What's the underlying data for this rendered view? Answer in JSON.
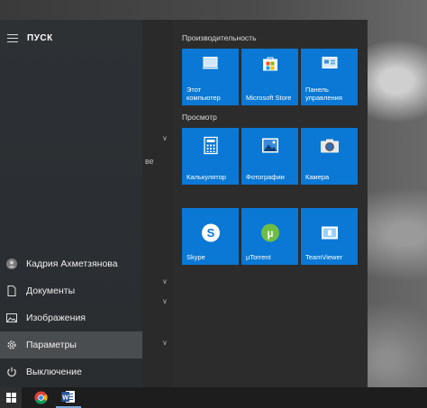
{
  "menu": {
    "title": "ПУСК"
  },
  "left_items": [
    {
      "label": "Кадрия Ахметзянова",
      "icon": "user-avatar-icon"
    },
    {
      "label": "Документы",
      "icon": "document-icon"
    },
    {
      "label": "Изображения",
      "icon": "pictures-icon"
    },
    {
      "label": "Параметры",
      "icon": "gear-icon"
    },
    {
      "label": "Выключение",
      "icon": "power-icon"
    }
  ],
  "applist": {
    "fragment": "ве"
  },
  "groups": [
    {
      "title": "Производительность"
    },
    {
      "title": "Просмотр"
    }
  ],
  "tiles": [
    {
      "label_line1": "Этот",
      "label_line2": "компьютер",
      "icon": "computer-icon"
    },
    {
      "label_line1": "Microsoft Store",
      "label_line2": "",
      "icon": "store-icon"
    },
    {
      "label_line1": "Панель",
      "label_line2": "управления",
      "icon": "control-panel-icon"
    },
    {
      "label_line1": "Калькулятор",
      "label_line2": "",
      "icon": "calculator-icon"
    },
    {
      "label_line1": "Фотографии",
      "label_line2": "",
      "icon": "photos-icon"
    },
    {
      "label_line1": "Камера",
      "label_line2": "",
      "icon": "camera-icon"
    },
    {
      "label_line1": "Skype",
      "label_line2": "",
      "icon": "skype-icon"
    },
    {
      "label_line1": "µTorrent",
      "label_line2": "",
      "icon": "utorrent-icon"
    },
    {
      "label_line1": "TeamViewer",
      "label_line2": "",
      "icon": "teamviewer-icon"
    }
  ],
  "taskbar": {
    "apps": [
      {
        "name": "Chrome",
        "icon": "chrome-icon"
      },
      {
        "name": "Word",
        "icon": "word-icon"
      }
    ]
  },
  "colors": {
    "tile": "#0a78d4",
    "rail": "#2b2f33",
    "taskbar": "#1d1d1d"
  }
}
